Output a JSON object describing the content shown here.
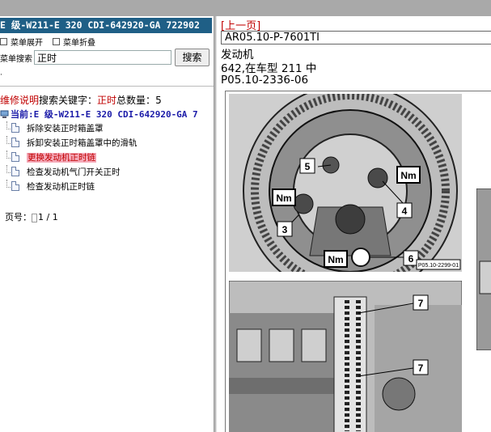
{
  "left_panel": {
    "title": "E 级-W211-E 320 CDI-642920-GA 722902",
    "menu": {
      "expand_label": "菜单展开",
      "collapse_label": "菜单折叠"
    },
    "search": {
      "label": "菜单搜索",
      "value": "正时",
      "button_label": "搜索"
    },
    "result_header": {
      "prefix": "维修说明",
      "keyword_label": "搜索关键字：",
      "keyword": "正时",
      "count_label": "总数量：",
      "count": "5"
    },
    "current_label": "当前:E 级-W211-E 320 CDI-642920-GA 7",
    "tree_items": [
      {
        "label": "拆除安装正时箱盖罩",
        "selected": false
      },
      {
        "label": "拆卸安装正时箱盖罩中的滑轨",
        "selected": false
      },
      {
        "label": "更换发动机正时链",
        "selected": true
      },
      {
        "label": "检查发动机气门开关正时",
        "selected": false
      },
      {
        "label": "检查发动机正时链",
        "selected": false
      }
    ],
    "pager": {
      "label": "页号：",
      "value": "1 / 1"
    }
  },
  "right_panel": {
    "prev_link": "[上一页]",
    "doc_id": "AR05.10-P-7601TI",
    "line_engine": "发动机",
    "line_model": "642,在车型 211 中",
    "line_figure": "P05.10-2336-06",
    "figure_top": {
      "callouts": [
        "5",
        "4",
        "3",
        "6"
      ],
      "torque_label": "Nm",
      "code": "P05.10-2299-01"
    },
    "figure_bottom": {
      "callouts": [
        "7",
        "7"
      ]
    }
  },
  "colors": {
    "title_bg": "#1f5f86",
    "accent_red": "#c00000",
    "selected_bg": "#f4a9b8",
    "link_blue": "#1a1aa8"
  }
}
